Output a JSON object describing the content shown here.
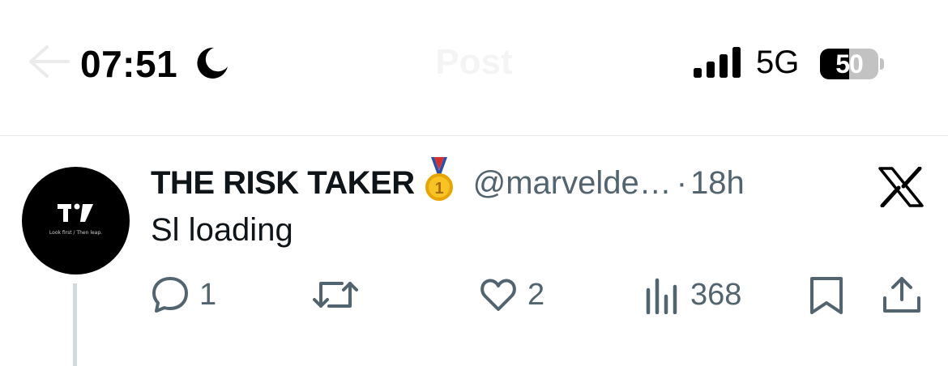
{
  "status_bar": {
    "time": "07:51",
    "network": "5G",
    "battery_percent": "50",
    "battery_level": 0.5
  },
  "header": {
    "title": "Post"
  },
  "tweet": {
    "display_name": "THE RISK TAKER",
    "handle": "@marvelde…",
    "separator": "·",
    "timestamp": "18h",
    "text": "Sl loading",
    "avatar_logo_text": "TV",
    "avatar_tagline": "Look first / Then leap.",
    "badge_icon": "first-place-medal-icon",
    "source_icon": "x-logo-icon"
  },
  "actions": {
    "replies": "1",
    "retweets": "",
    "likes": "2",
    "views": "368"
  },
  "colors": {
    "text_primary": "#0f1419",
    "text_secondary": "#536471",
    "divider": "#e7e9ea",
    "thread_line": "#cfd9de",
    "medal_gold": "#f4b400",
    "ribbon_blue": "#2b4fa3",
    "ribbon_red": "#d62d2d"
  }
}
